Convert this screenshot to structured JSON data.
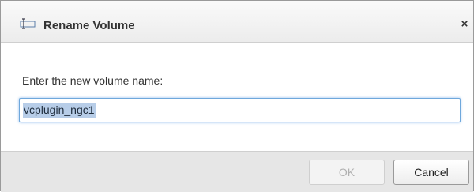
{
  "dialog": {
    "title": "Rename Volume",
    "title_icon": "rename-volume-icon",
    "close_label": "×",
    "prompt": "Enter the new volume name:",
    "input_value": "vcplugin_ngc1",
    "ok_label": "OK",
    "cancel_label": "Cancel",
    "ok_enabled": false
  },
  "colors": {
    "input_focus_border": "#6fa8dc",
    "selection_highlight": "#b7cde8",
    "footer_background": "#e6e6e6"
  }
}
